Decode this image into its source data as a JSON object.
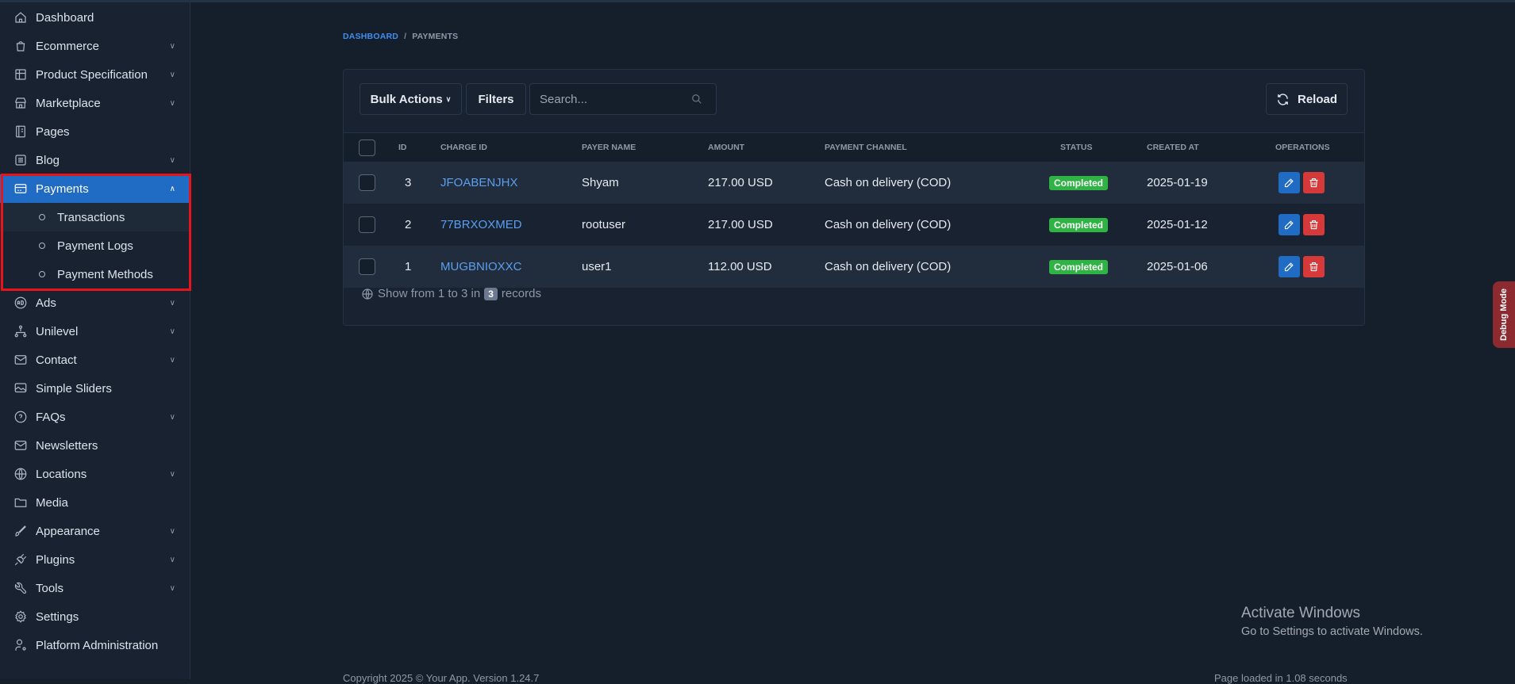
{
  "sidebar": {
    "items": [
      {
        "label": "Dashboard",
        "icon": "home-icon",
        "chevron": false
      },
      {
        "label": "Ecommerce",
        "icon": "shopping-bag-icon",
        "chevron": true
      },
      {
        "label": "Product Specification",
        "icon": "table-settings-icon",
        "chevron": true
      },
      {
        "label": "Marketplace",
        "icon": "store-icon",
        "chevron": true
      },
      {
        "label": "Pages",
        "icon": "notebook-icon",
        "chevron": false
      },
      {
        "label": "Blog",
        "icon": "article-icon",
        "chevron": true
      },
      {
        "label": "Payments",
        "icon": "credit-card-icon",
        "chevron": true,
        "active": true
      },
      {
        "label": "Ads",
        "icon": "ad-circle-icon",
        "chevron": true
      },
      {
        "label": "Unilevel",
        "icon": "hierarchy-icon",
        "chevron": true
      },
      {
        "label": "Contact",
        "icon": "mail-icon",
        "chevron": true
      },
      {
        "label": "Simple Sliders",
        "icon": "slideshow-icon",
        "chevron": false
      },
      {
        "label": "FAQs",
        "icon": "help-circle-icon",
        "chevron": true
      },
      {
        "label": "Newsletters",
        "icon": "mail-icon",
        "chevron": false
      },
      {
        "label": "Locations",
        "icon": "globe-icon",
        "chevron": true
      },
      {
        "label": "Media",
        "icon": "folder-icon",
        "chevron": false
      },
      {
        "label": "Appearance",
        "icon": "brush-icon",
        "chevron": true
      },
      {
        "label": "Plugins",
        "icon": "plug-icon",
        "chevron": true
      },
      {
        "label": "Tools",
        "icon": "tool-icon",
        "chevron": true
      },
      {
        "label": "Settings",
        "icon": "gear-icon",
        "chevron": false
      },
      {
        "label": "Platform Administration",
        "icon": "user-cog-icon",
        "chevron": false
      }
    ],
    "payments_sub": [
      "Transactions",
      "Payment Logs",
      "Payment Methods"
    ]
  },
  "breadcrumb": {
    "home": "DASHBOARD",
    "separator": "/",
    "current": "PAYMENTS"
  },
  "toolbar": {
    "bulk_actions": "Bulk Actions",
    "filters": "Filters",
    "search_placeholder": "Search...",
    "reload": "Reload"
  },
  "table": {
    "headers": {
      "id": "ID",
      "charge_id": "CHARGE ID",
      "payer_name": "PAYER NAME",
      "amount": "AMOUNT",
      "payment_channel": "PAYMENT CHANNEL",
      "status": "STATUS",
      "created_at": "CREATED AT",
      "operations": "OPERATIONS"
    },
    "rows": [
      {
        "id": "3",
        "charge_id": "JFOABENJHX",
        "payer_name": "Shyam",
        "amount": "217.00 USD",
        "payment_channel": "Cash on delivery (COD)",
        "status": "Completed",
        "created_at": "2025-01-19"
      },
      {
        "id": "2",
        "charge_id": "77BRXOXMED",
        "payer_name": "rootuser",
        "amount": "217.00 USD",
        "payment_channel": "Cash on delivery (COD)",
        "status": "Completed",
        "created_at": "2025-01-12"
      },
      {
        "id": "1",
        "charge_id": "MUGBNIOXXC",
        "payer_name": "user1",
        "amount": "112.00 USD",
        "payment_channel": "Cash on delivery (COD)",
        "status": "Completed",
        "created_at": "2025-01-06"
      }
    ],
    "footer": {
      "prefix": "Show from 1 to 3 in",
      "count": "3",
      "suffix": "records"
    }
  },
  "windows": {
    "title": "Activate Windows",
    "subtitle": "Go to Settings to activate Windows."
  },
  "footer": {
    "copyright": "Copyright 2025 © Your App. Version 1.24.7",
    "loaded": "Page loaded in 1.08 seconds"
  },
  "debug": "Debug Mode",
  "colors": {
    "accent": "#206bc4",
    "success": "#2fb344",
    "danger": "#d63939",
    "highlight": "#e8141b"
  }
}
